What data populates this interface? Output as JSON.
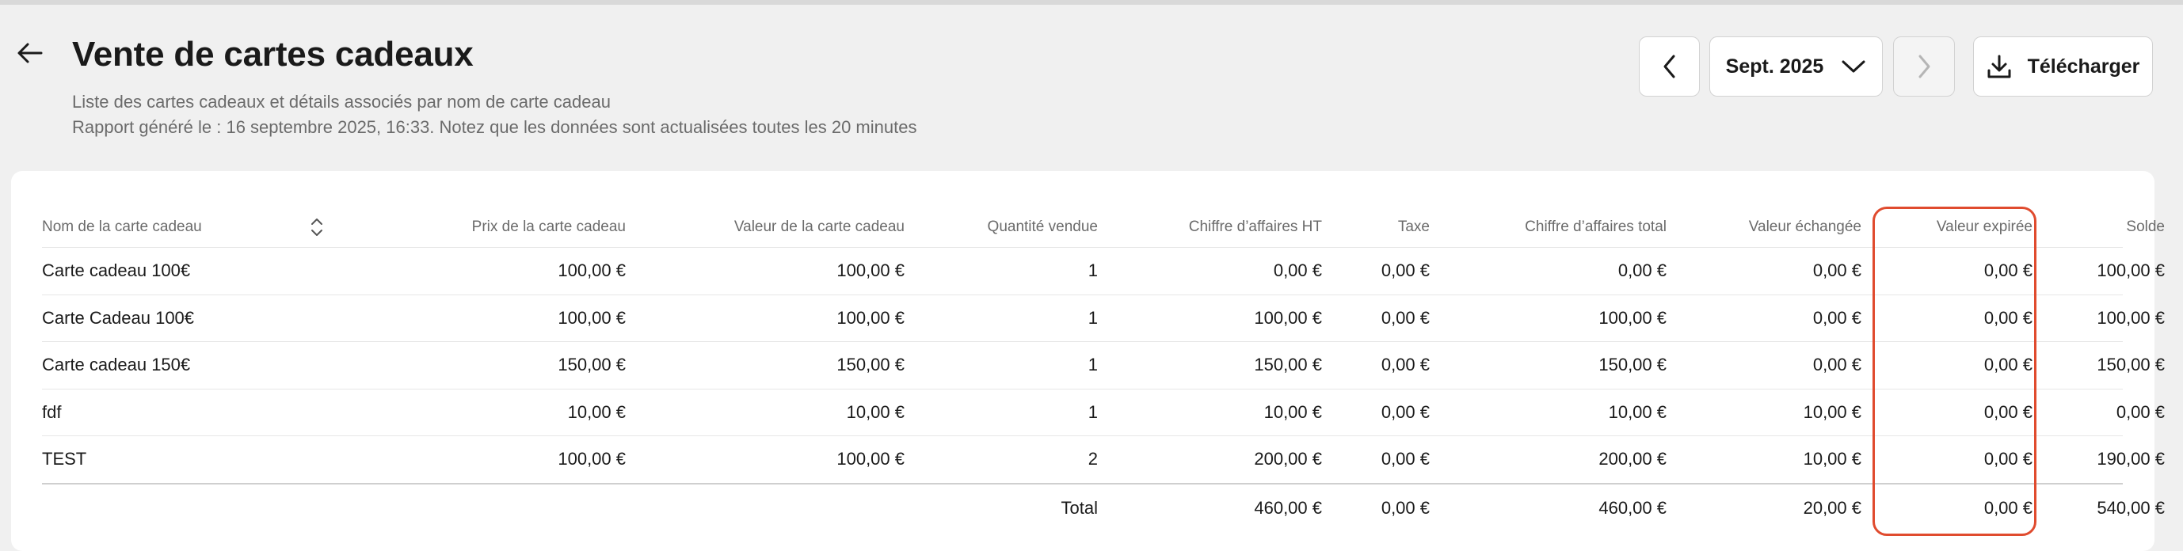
{
  "header": {
    "title": "Vente de cartes cadeaux",
    "subtitle1": "Liste des cartes cadeaux et détails associés par nom de carte cadeau",
    "subtitle2": "Rapport généré le : 16 septembre 2025, 16:33. Notez que les données sont actualisées toutes les 20 minutes",
    "back_icon": "arrow-left-icon"
  },
  "toolbar": {
    "prev_icon": "chevron-left-icon",
    "month_label": "Sept. 2025",
    "month_icon": "chevron-down-icon",
    "next_icon": "chevron-right-icon",
    "download_label": "Télécharger",
    "download_icon": "download-icon"
  },
  "table": {
    "columns": [
      "Nom de la carte cadeau",
      "Prix de la carte cadeau",
      "Valeur de la carte cadeau",
      "Quantité vendue",
      "Chiffre d’affaires HT",
      "Taxe",
      "Chiffre d’affaires total",
      "Valeur échangée",
      "Valeur expirée",
      "Solde"
    ],
    "rows": [
      [
        "Carte cadeau 100€",
        "100,00 €",
        "100,00 €",
        "1",
        "0,00 €",
        "0,00 €",
        "0,00 €",
        "0,00 €",
        "0,00 €",
        "100,00 €"
      ],
      [
        "Carte Cadeau 100€",
        "100,00 €",
        "100,00 €",
        "1",
        "100,00 €",
        "0,00 €",
        "100,00 €",
        "0,00 €",
        "0,00 €",
        "100,00 €"
      ],
      [
        "Carte cadeau 150€",
        "150,00 €",
        "150,00 €",
        "1",
        "150,00 €",
        "0,00 €",
        "150,00 €",
        "0,00 €",
        "0,00 €",
        "150,00 €"
      ],
      [
        "fdf",
        "10,00 €",
        "10,00 €",
        "1",
        "10,00 €",
        "0,00 €",
        "10,00 €",
        "10,00 €",
        "0,00 €",
        "0,00 €"
      ],
      [
        "TEST",
        "100,00 €",
        "100,00 €",
        "2",
        "200,00 €",
        "0,00 €",
        "200,00 €",
        "10,00 €",
        "0,00 €",
        "190,00 €"
      ]
    ],
    "total": {
      "label": "Total",
      "values": [
        "460,00 €",
        "0,00 €",
        "460,00 €",
        "20,00 €",
        "0,00 €",
        "540,00 €"
      ]
    },
    "sort_icon": "sort-icon"
  },
  "colors": {
    "background": "#f0f0f0",
    "card": "#ffffff",
    "highlight": "#e04b2e"
  }
}
